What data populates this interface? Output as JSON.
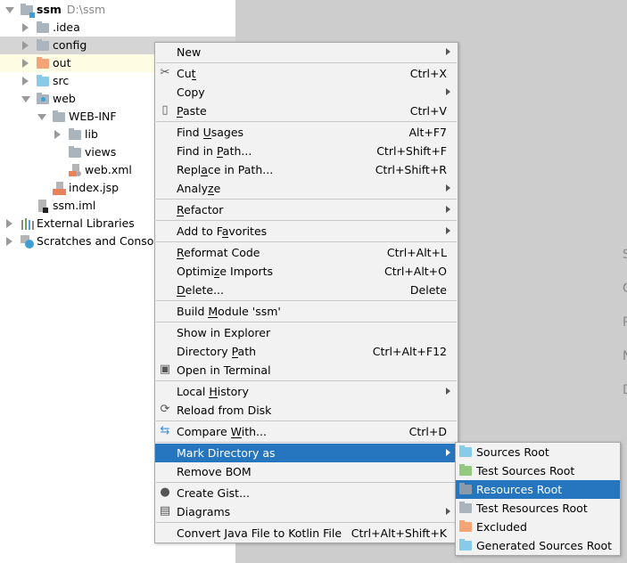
{
  "tree": {
    "items": [
      {
        "label": "ssm",
        "path": "D:\\ssm",
        "icon": "module-folder-icon",
        "expanded": true,
        "depth": 0,
        "bold": true
      },
      {
        "label": ".idea",
        "icon": "folder-icon",
        "expanded": false,
        "depth": 1
      },
      {
        "label": "config",
        "icon": "folder-icon",
        "expanded": false,
        "depth": 1,
        "selected": true
      },
      {
        "label": "out",
        "icon": "excluded-folder-icon",
        "expanded": false,
        "depth": 1,
        "highlighted": true
      },
      {
        "label": "src",
        "icon": "source-folder-icon",
        "expanded": false,
        "depth": 1
      },
      {
        "label": "web",
        "icon": "web-folder-icon",
        "expanded": true,
        "depth": 1
      },
      {
        "label": "WEB-INF",
        "icon": "folder-icon",
        "expanded": true,
        "depth": 2
      },
      {
        "label": "lib",
        "icon": "folder-icon",
        "expanded": false,
        "depth": 3
      },
      {
        "label": "views",
        "icon": "folder-icon",
        "depth": 3
      },
      {
        "label": "web.xml",
        "icon": "xml-file-icon",
        "depth": 3
      },
      {
        "label": "index.jsp",
        "icon": "jsp-file-icon",
        "depth": 2
      },
      {
        "label": "ssm.iml",
        "icon": "iml-file-icon",
        "depth": 1
      },
      {
        "label": "External Libraries",
        "icon": "libraries-icon",
        "expanded": false,
        "depth": 0
      },
      {
        "label": "Scratches and Consoles",
        "icon": "scratches-icon",
        "expanded": false,
        "depth": 0
      }
    ]
  },
  "colors": {
    "selection": "#2675bf",
    "menu_bg": "#f2f2f2",
    "folder": "#aab4bc",
    "source_folder": "#87cbe8",
    "excluded_folder": "#f4a475",
    "test_folder": "#93c97f"
  },
  "context_menu": {
    "items": [
      {
        "label": "New",
        "submenu": true
      },
      {
        "sep": true
      },
      {
        "label": "Cut",
        "shortcut": "Ctrl+X",
        "icon": "scissors-icon",
        "mn": 2
      },
      {
        "label": "Copy",
        "submenu": true
      },
      {
        "label": "Paste",
        "shortcut": "Ctrl+V",
        "icon": "clipboard-icon",
        "mn": 0
      },
      {
        "sep": true
      },
      {
        "label": "Find Usages",
        "shortcut": "Alt+F7",
        "mn": 5
      },
      {
        "label": "Find in Path...",
        "shortcut": "Ctrl+Shift+F",
        "mn": 8
      },
      {
        "label": "Replace in Path...",
        "shortcut": "Ctrl+Shift+R",
        "mn": 4
      },
      {
        "label": "Analyze",
        "submenu": true,
        "mn": 5
      },
      {
        "sep": true
      },
      {
        "label": "Refactor",
        "submenu": true,
        "mn": 0
      },
      {
        "sep": true
      },
      {
        "label": "Add to Favorites",
        "submenu": true,
        "mn": 8
      },
      {
        "sep": true
      },
      {
        "label": "Reformat Code",
        "shortcut": "Ctrl+Alt+L",
        "mn": 0
      },
      {
        "label": "Optimize Imports",
        "shortcut": "Ctrl+Alt+O",
        "mn": 6
      },
      {
        "label": "Delete...",
        "shortcut": "Delete",
        "mn": 0
      },
      {
        "sep": true
      },
      {
        "label": "Build Module 'ssm'",
        "mn": 6
      },
      {
        "sep": true
      },
      {
        "label": "Show in Explorer"
      },
      {
        "label": "Directory Path",
        "shortcut": "Ctrl+Alt+F12",
        "mn": 10
      },
      {
        "label": "Open in Terminal",
        "icon": "terminal-icon"
      },
      {
        "sep": true
      },
      {
        "label": "Local History",
        "submenu": true,
        "mn": 6
      },
      {
        "label": "Reload from Disk",
        "icon": "reload-icon"
      },
      {
        "sep": true
      },
      {
        "label": "Compare With...",
        "shortcut": "Ctrl+D",
        "icon": "compare-icon",
        "mn": 8
      },
      {
        "sep": true
      },
      {
        "label": "Mark Directory as",
        "submenu": true,
        "active": true
      },
      {
        "label": "Remove BOM"
      },
      {
        "sep": true
      },
      {
        "label": "Create Gist...",
        "icon": "github-icon"
      },
      {
        "label": "Diagrams",
        "submenu": true,
        "icon": "diagram-icon"
      },
      {
        "sep": true
      },
      {
        "label": "Convert Java File to Kotlin File",
        "shortcut": "Ctrl+Alt+Shift+K"
      }
    ]
  },
  "submenu": {
    "items": [
      {
        "label": "Sources Root",
        "icon": "sources-root-icon",
        "color": "#87cbe8"
      },
      {
        "label": "Test Sources Root",
        "icon": "test-sources-root-icon",
        "color": "#93c97f"
      },
      {
        "label": "Resources Root",
        "icon": "resources-root-icon",
        "color": "#8a9aa8",
        "active": true
      },
      {
        "label": "Test Resources Root",
        "icon": "test-resources-root-icon",
        "color": "#aab4bc"
      },
      {
        "label": "Excluded",
        "icon": "excluded-icon",
        "color": "#f4a475"
      },
      {
        "label": "Generated Sources Root",
        "icon": "generated-sources-root-icon",
        "color": "#87cbe8"
      }
    ]
  },
  "right_panel": {
    "letters": [
      "S",
      "G",
      "R",
      "N",
      "D"
    ]
  }
}
